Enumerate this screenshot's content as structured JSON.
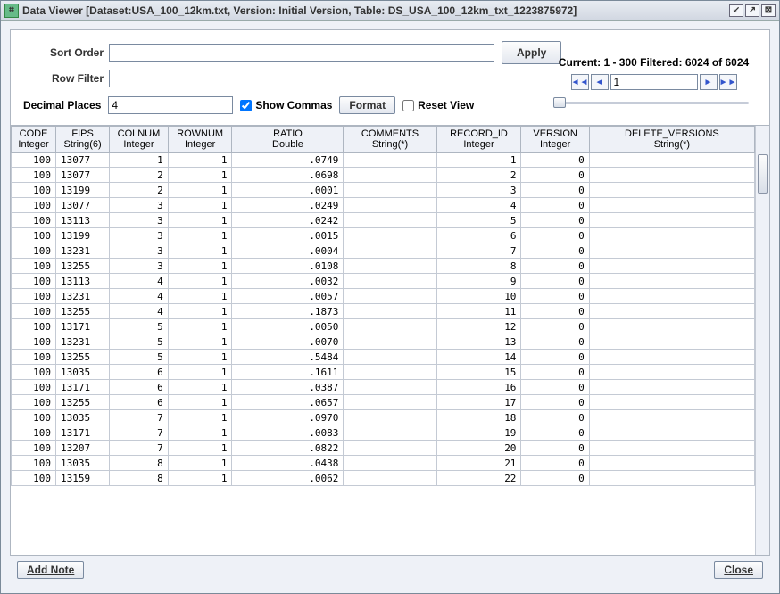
{
  "title": "Data Viewer [Dataset:USA_100_12km.txt, Version: Initial Version, Table: DS_USA_100_12km_txt_1223875972]",
  "labels": {
    "sort_order": "Sort Order",
    "row_filter": "Row Filter",
    "decimal_places": "Decimal Places",
    "apply": "Apply",
    "show_commas": "Show Commas",
    "format": "Format",
    "reset_view": "Reset View",
    "add_note": "Add Note",
    "close": "Close"
  },
  "inputs": {
    "sort_order": "",
    "row_filter": "",
    "decimal_places": "4",
    "page": "1"
  },
  "checks": {
    "show_commas": true,
    "reset_view": false
  },
  "pager": {
    "status": "Current: 1 - 300 Filtered: 6024 of 6024",
    "first": "◄◄",
    "prev": "◄",
    "next": "►",
    "last": "►►"
  },
  "columns": [
    {
      "name": "CODE",
      "type": "Integer",
      "align": "r"
    },
    {
      "name": "FIPS",
      "type": "String(6)",
      "align": "l"
    },
    {
      "name": "COLNUM",
      "type": "Integer",
      "align": "r"
    },
    {
      "name": "ROWNUM",
      "type": "Integer",
      "align": "r"
    },
    {
      "name": "RATIO",
      "type": "Double",
      "align": "r"
    },
    {
      "name": "COMMENTS",
      "type": "String(*)",
      "align": "l"
    },
    {
      "name": "RECORD_ID",
      "type": "Integer",
      "align": "r"
    },
    {
      "name": "VERSION",
      "type": "Integer",
      "align": "r"
    },
    {
      "name": "DELETE_VERSIONS",
      "type": "String(*)",
      "align": "l"
    }
  ],
  "rows": [
    [
      "100",
      "13077",
      "1",
      "1",
      ".0749",
      "",
      "1",
      "0",
      ""
    ],
    [
      "100",
      "13077",
      "2",
      "1",
      ".0698",
      "",
      "2",
      "0",
      ""
    ],
    [
      "100",
      "13199",
      "2",
      "1",
      ".0001",
      "",
      "3",
      "0",
      ""
    ],
    [
      "100",
      "13077",
      "3",
      "1",
      ".0249",
      "",
      "4",
      "0",
      ""
    ],
    [
      "100",
      "13113",
      "3",
      "1",
      ".0242",
      "",
      "5",
      "0",
      ""
    ],
    [
      "100",
      "13199",
      "3",
      "1",
      ".0015",
      "",
      "6",
      "0",
      ""
    ],
    [
      "100",
      "13231",
      "3",
      "1",
      ".0004",
      "",
      "7",
      "0",
      ""
    ],
    [
      "100",
      "13255",
      "3",
      "1",
      ".0108",
      "",
      "8",
      "0",
      ""
    ],
    [
      "100",
      "13113",
      "4",
      "1",
      ".0032",
      "",
      "9",
      "0",
      ""
    ],
    [
      "100",
      "13231",
      "4",
      "1",
      ".0057",
      "",
      "10",
      "0",
      ""
    ],
    [
      "100",
      "13255",
      "4",
      "1",
      ".1873",
      "",
      "11",
      "0",
      ""
    ],
    [
      "100",
      "13171",
      "5",
      "1",
      ".0050",
      "",
      "12",
      "0",
      ""
    ],
    [
      "100",
      "13231",
      "5",
      "1",
      ".0070",
      "",
      "13",
      "0",
      ""
    ],
    [
      "100",
      "13255",
      "5",
      "1",
      ".5484",
      "",
      "14",
      "0",
      ""
    ],
    [
      "100",
      "13035",
      "6",
      "1",
      ".1611",
      "",
      "15",
      "0",
      ""
    ],
    [
      "100",
      "13171",
      "6",
      "1",
      ".0387",
      "",
      "16",
      "0",
      ""
    ],
    [
      "100",
      "13255",
      "6",
      "1",
      ".0657",
      "",
      "17",
      "0",
      ""
    ],
    [
      "100",
      "13035",
      "7",
      "1",
      ".0970",
      "",
      "18",
      "0",
      ""
    ],
    [
      "100",
      "13171",
      "7",
      "1",
      ".0083",
      "",
      "19",
      "0",
      ""
    ],
    [
      "100",
      "13207",
      "7",
      "1",
      ".0822",
      "",
      "20",
      "0",
      ""
    ],
    [
      "100",
      "13035",
      "8",
      "1",
      ".0438",
      "",
      "21",
      "0",
      ""
    ],
    [
      "100",
      "13159",
      "8",
      "1",
      ".0062",
      "",
      "22",
      "0",
      ""
    ]
  ]
}
